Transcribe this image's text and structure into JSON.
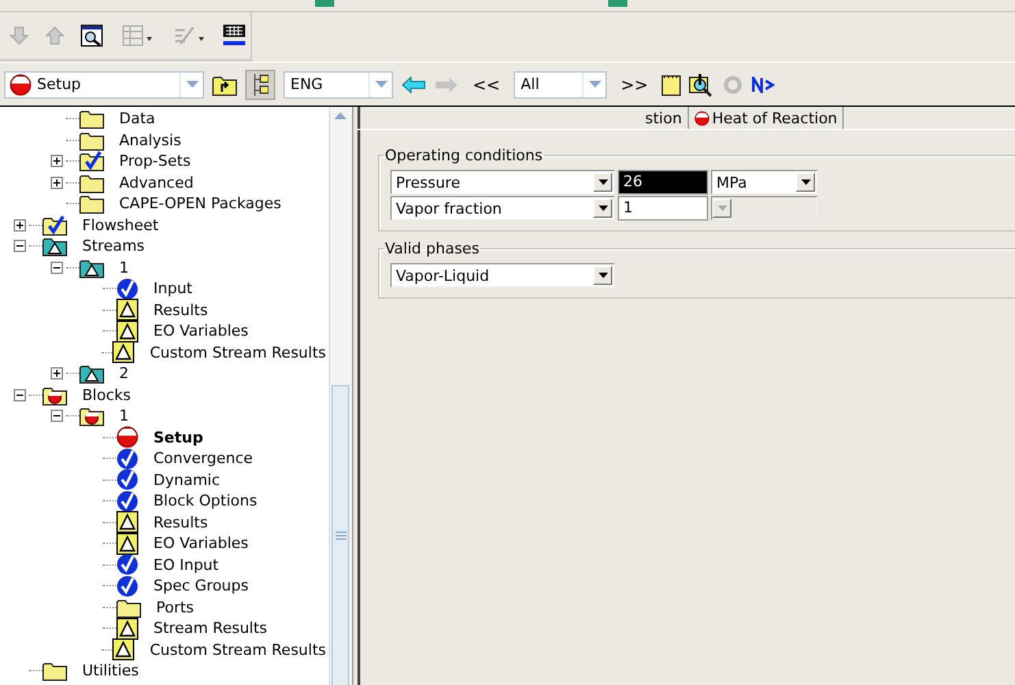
{
  "nav_bar": {
    "form_selector": {
      "value": "Setup"
    },
    "units": {
      "value": "ENG"
    },
    "back": "<<",
    "filter": {
      "value": "All"
    },
    "forward": ">>"
  },
  "tree": [
    {
      "children": [
        {
          "label": "Data",
          "kind": "folder"
        },
        {
          "label": "Analysis",
          "kind": "folder"
        },
        {
          "label": "Prop-Sets",
          "kind": "folder-check",
          "expanded": false
        },
        {
          "label": "Advanced",
          "kind": "folder",
          "expanded": false
        },
        {
          "label": "CAPE-OPEN Packages",
          "kind": "folder"
        }
      ]
    },
    {
      "label": "Flowsheet",
      "kind": "folder-check",
      "expanded": false
    },
    {
      "label": "Streams",
      "kind": "folder-triangle",
      "expanded": true,
      "children": [
        {
          "label": "1",
          "kind": "folder-triangle",
          "expanded": true,
          "children": [
            {
              "label": "Input",
              "kind": "check"
            },
            {
              "label": "Results",
              "kind": "triangle"
            },
            {
              "label": "EO Variables",
              "kind": "triangle"
            },
            {
              "label": "Custom Stream Results",
              "kind": "triangle"
            }
          ]
        },
        {
          "label": "2",
          "kind": "folder-triangle",
          "expanded": false
        }
      ]
    },
    {
      "label": "Blocks",
      "kind": "folder-red",
      "expanded": true,
      "children": [
        {
          "label": "1",
          "kind": "folder-red",
          "expanded": true,
          "children": [
            {
              "label": "Setup",
              "kind": "red",
              "selected": true
            },
            {
              "label": "Convergence",
              "kind": "check",
              "selected": false
            },
            {
              "label": "Dynamic",
              "kind": "check",
              "selected": false
            },
            {
              "label": "Block Options",
              "kind": "check",
              "selected": false
            },
            {
              "label": "Results",
              "kind": "triangle",
              "selected": false
            },
            {
              "label": "EO Variables",
              "kind": "triangle",
              "selected": false
            },
            {
              "label": "EO Input",
              "kind": "check",
              "selected": false
            },
            {
              "label": "Spec Groups",
              "kind": "check",
              "selected": false
            },
            {
              "label": "Ports",
              "kind": "folder",
              "selected": false
            },
            {
              "label": "Stream Results",
              "kind": "triangle",
              "selected": false
            },
            {
              "label": "Custom Stream Results",
              "kind": "triangle",
              "selected": false
            }
          ]
        }
      ]
    },
    {
      "label": "Utilities",
      "kind": "folder"
    }
  ],
  "tabs": [
    {
      "label": "stion",
      "selected": false,
      "kind": "none"
    },
    {
      "label": "Heat of Reaction",
      "selected": false,
      "kind": "red"
    }
  ],
  "operating_conditions": {
    "title": "Operating conditions",
    "rows": [
      {
        "spec": "Pressure",
        "value": "26",
        "selected": true,
        "unit": "MPa",
        "unit_disabled": false
      },
      {
        "spec": "Vapor fraction",
        "value": "1",
        "selected": false,
        "unit_disabled": true
      }
    ]
  },
  "valid_phases": {
    "title": "Valid phases",
    "value": "Vapor-Liquid"
  }
}
